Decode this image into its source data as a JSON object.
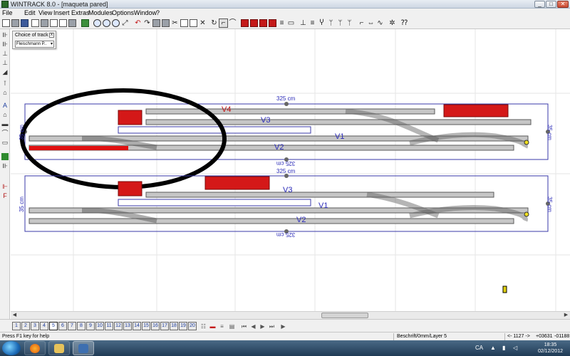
{
  "window": {
    "title": "WINTRACK 8.0 - [maqueta pared]",
    "minimize": "_",
    "maximize": "□",
    "close": "✕"
  },
  "menu": {
    "items": [
      "File",
      "Edit",
      "View",
      "Insert",
      "Extras",
      "Modules",
      "Options",
      "Window",
      "?"
    ]
  },
  "choice_panel": {
    "label": "Choice of track",
    "close": "x",
    "selected": "Fleischmann P..",
    "arrow": "▾"
  },
  "canvas": {
    "upper_board": {
      "length_label": "325 cm",
      "length_label_bottom": "325 cm",
      "height_label_left": "35 cm",
      "height_label_right": "35 cm",
      "track_labels": {
        "v4": "V4",
        "v3": "V3",
        "v1": "V1",
        "v2": "V2"
      }
    },
    "lower_board": {
      "length_label": "325 cm",
      "length_label_bottom": "325 cm",
      "height_label_left": "35 cm",
      "height_label_right": "35 cm",
      "track_labels": {
        "v3": "V3",
        "v1": "V1",
        "v2": "V2"
      }
    },
    "colors": {
      "board_outline": "#3a3aa8",
      "track_fill": "#c6c6c6",
      "track_edge": "#5a5a5a",
      "building": "#d41818",
      "annotation_ring": "#000000",
      "grid": "#e6e6e6"
    }
  },
  "layers": {
    "buttons": [
      "1",
      "2",
      "3",
      "4",
      "5",
      "6",
      "7",
      "8",
      "9",
      "10",
      "11",
      "12",
      "13",
      "14",
      "15",
      "16",
      "17",
      "18",
      "19",
      "20"
    ],
    "active": "5"
  },
  "status": {
    "help": "Press F1 key for help",
    "layer_info": "Beschrift/0mm/Layer 5",
    "page_counter": "<- 1127 ->",
    "x_coord": "+03631",
    "y_coord": "-01188"
  },
  "taskbar": {
    "language": "CA",
    "time": "18:35",
    "date": "02/12/2012"
  },
  "icons": {
    "toolbar": [
      "new-icon",
      "open-icon",
      "save-icon",
      "print-preview-icon",
      "print-icon",
      "copy-icon",
      "doc-icon",
      "export-icon",
      "zoom-in-icon",
      "zoom-out-icon",
      "zoom-fit-icon",
      "zoom-window-icon",
      "undo-icon",
      "redo-icon",
      "table-icon",
      "grid-icon",
      "cut-icon",
      "copy-icon",
      "paste-icon",
      "delete-icon",
      "rotate-icon",
      "select-icon",
      "curve-icon",
      "draw-icon",
      "building-icon",
      "signal-icon"
    ]
  }
}
